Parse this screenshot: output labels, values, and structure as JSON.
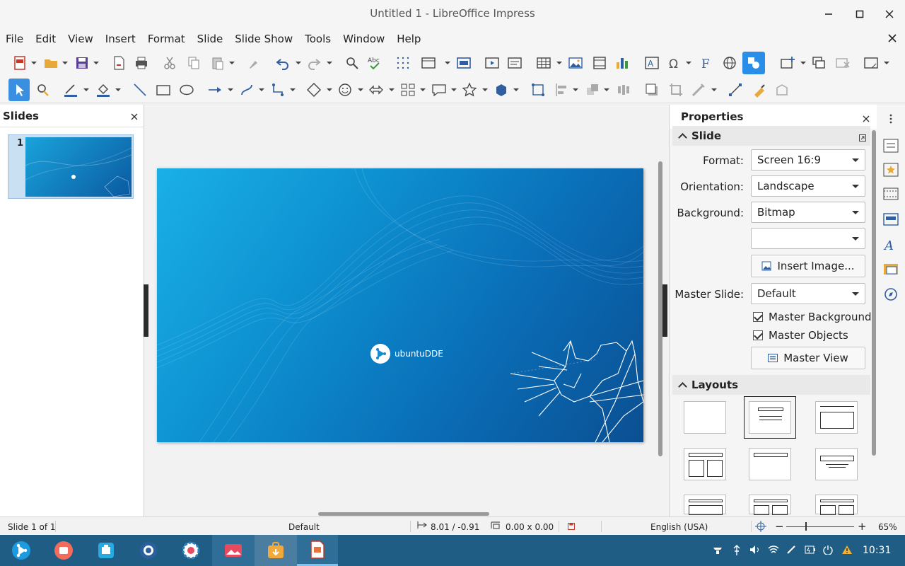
{
  "window": {
    "title": "Untitled 1 - LibreOffice Impress"
  },
  "menu": [
    "File",
    "Edit",
    "View",
    "Insert",
    "Format",
    "Slide",
    "Slide Show",
    "Tools",
    "Window",
    "Help"
  ],
  "slides_pane": {
    "title": "Slides",
    "thumb_number": "1"
  },
  "slide": {
    "brand_text": "ubuntuDDE"
  },
  "properties": {
    "title": "Properties",
    "slide_section": "Slide",
    "format_label": "Format:",
    "format_value": "Screen 16:9",
    "orientation_label": "Orientation:",
    "orientation_value": "Landscape",
    "background_label": "Background:",
    "background_value": "Bitmap",
    "background_sub_value": "",
    "insert_image": "Insert Image...",
    "master_slide_label": "Master Slide:",
    "master_slide_value": "Default",
    "master_background": "Master Background",
    "master_objects": "Master Objects",
    "master_view": "Master View",
    "layouts_section": "Layouts"
  },
  "status": {
    "slide_info": "Slide 1 of 1",
    "master": "Default",
    "position": "8.01 / -0.91",
    "size": "0.00 x 0.00",
    "language": "English (USA)",
    "zoom": "65%"
  },
  "taskbar": {
    "clock": "10:31"
  },
  "colors": {
    "accent": "#2a8ee8",
    "taskbar": "#1f5d84",
    "slide_dark": "#0b4f92",
    "slide_light": "#1ab0e6"
  }
}
